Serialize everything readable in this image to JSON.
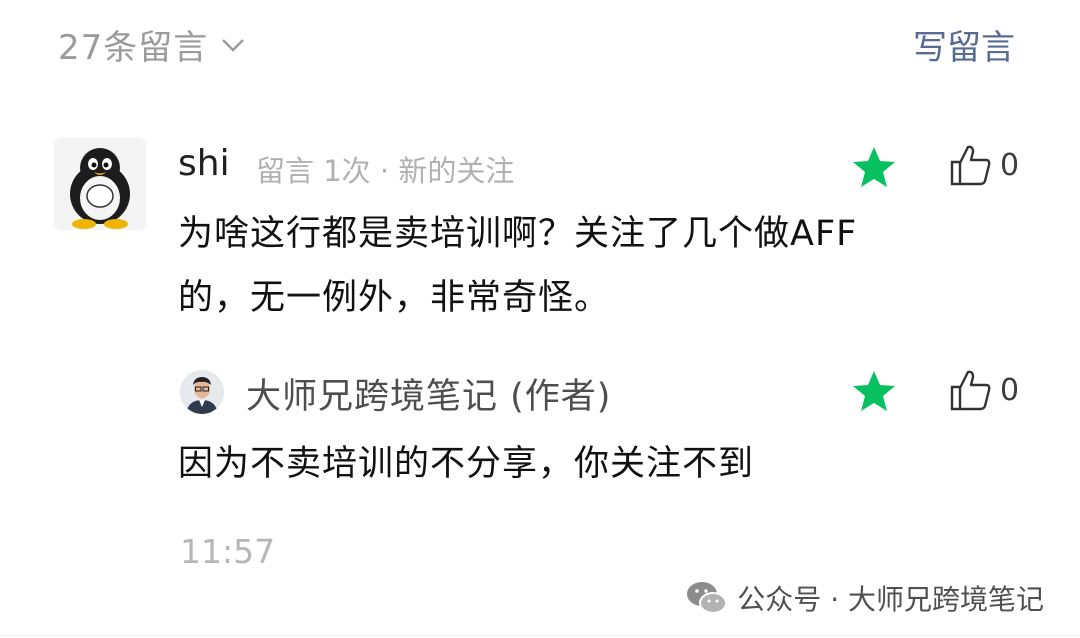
{
  "header": {
    "comment_count": "27条留言",
    "write_label": "写留言"
  },
  "comment": {
    "user": "shi",
    "meta": "留言 1次 · 新的关注",
    "text_line1": "为啥这行都是卖培训啊？关注了几个做AFF",
    "text_line2": "的，无一例外，非常奇怪。",
    "likes": "0"
  },
  "reply": {
    "user": "大师兄跨境笔记 (作者)",
    "text": "因为不卖培训的不分享，你关注不到",
    "likes": "0"
  },
  "timestamp": "11:57",
  "watermark": {
    "text": "公众号 · 大师兄跨境笔记"
  },
  "colors": {
    "link_blue": "#576b95",
    "star_green": "#07c160",
    "muted_gray": "#9b9b9b"
  }
}
